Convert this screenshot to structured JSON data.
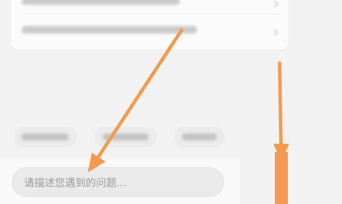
{
  "input": {
    "placeholder": "请描述您遇到的问题..."
  },
  "annotation_arrows": {
    "color": "#f39a4e",
    "count": 2
  }
}
